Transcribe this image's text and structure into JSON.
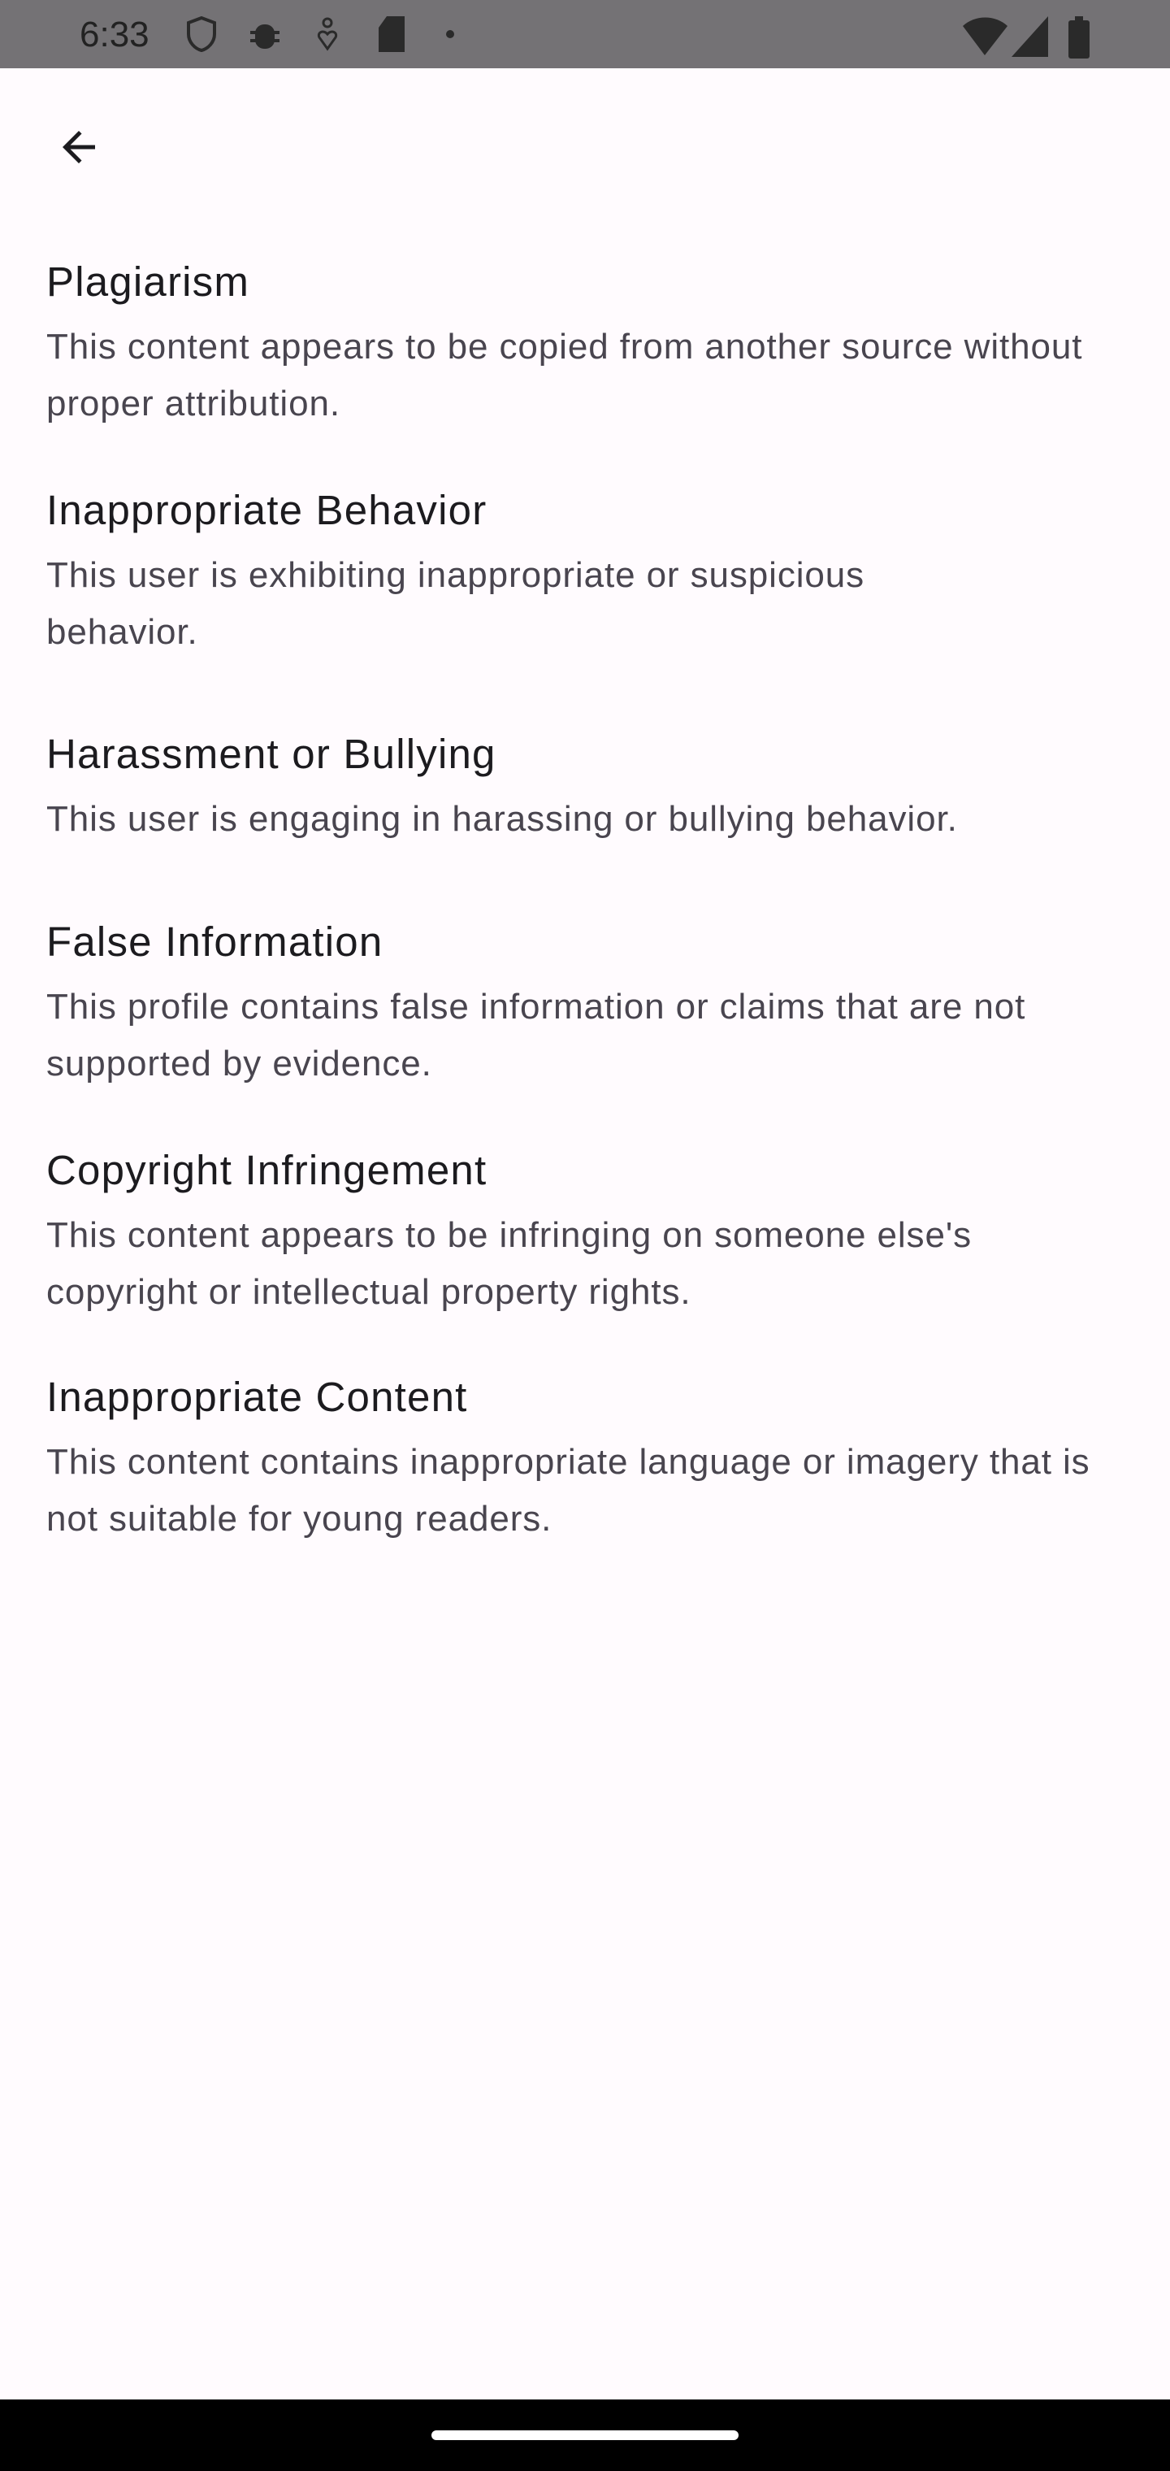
{
  "status_bar": {
    "time": "6:33"
  },
  "header": {
    "back_icon": "arrow-back-icon"
  },
  "reasons": [
    {
      "title": "Plagiarism",
      "description": "This content appears to be copied from another source without proper attribution."
    },
    {
      "title": "Inappropriate Behavior",
      "description": "This user is exhibiting inappropriate or suspicious behavior."
    },
    {
      "title": "Harassment or Bullying",
      "description": "This user is engaging in harassing or bullying behavior."
    },
    {
      "title": "False Information",
      "description": "This profile contains false information or claims that are not supported by evidence."
    },
    {
      "title": "Copyright Infringement",
      "description": "This content appears to be infringing on someone else's copyright or intellectual property rights."
    },
    {
      "title": "Inappropriate Content",
      "description": "This content contains inappropriate language or imagery that is not suitable for young readers."
    }
  ],
  "colors": {
    "background": "#FFFBFE",
    "title": "#1C1B1F",
    "description": "#49454F",
    "status_bar": "#747275"
  }
}
